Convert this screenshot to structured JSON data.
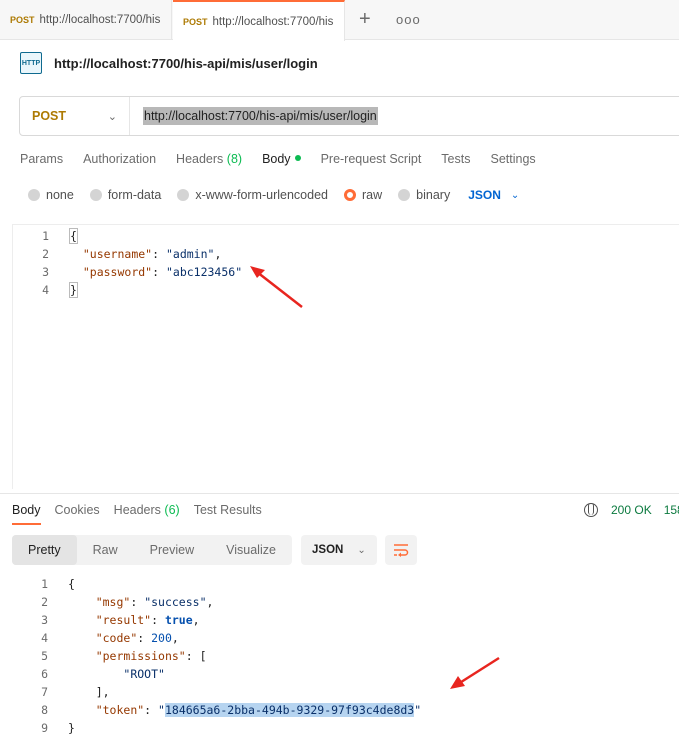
{
  "tabs": [
    {
      "method": "POST",
      "url": "http://localhost:7700/his"
    },
    {
      "method": "POST",
      "url": "http://localhost:7700/his"
    }
  ],
  "tab_actions": {
    "new": "+",
    "more": "ooo"
  },
  "request": {
    "icon_text": "HTTP",
    "title": "http://localhost:7700/his-api/mis/user/login",
    "method": "POST",
    "url": "http://localhost:7700/his-api/mis/user/login"
  },
  "request_tabs": {
    "params": "Params",
    "authorization": "Authorization",
    "headers": "Headers",
    "headers_count": "(8)",
    "body": "Body",
    "prerequest": "Pre-request Script",
    "tests": "Tests",
    "settings": "Settings"
  },
  "body_types": {
    "none": "none",
    "form_data": "form-data",
    "urlencoded": "x-www-form-urlencoded",
    "raw": "raw",
    "binary": "binary",
    "format": "JSON"
  },
  "request_body": {
    "line_numbers": [
      "1",
      "2",
      "3",
      "4"
    ],
    "username_key": "\"username\"",
    "username_value": "\"admin\"",
    "password_key": "\"password\"",
    "password_value": "\"abc123456\""
  },
  "response_tabs": {
    "body": "Body",
    "cookies": "Cookies",
    "headers": "Headers",
    "headers_count": "(6)",
    "test_results": "Test Results"
  },
  "status": {
    "code": "200 OK",
    "time": "158"
  },
  "view_modes": {
    "pretty": "Pretty",
    "raw": "Raw",
    "preview": "Preview",
    "visualize": "Visualize"
  },
  "response_format": "JSON",
  "response_body": {
    "line_numbers": [
      "1",
      "2",
      "3",
      "4",
      "5",
      "6",
      "7",
      "8",
      "9"
    ],
    "msg_key": "\"msg\"",
    "msg_value": "\"success\"",
    "result_key": "\"result\"",
    "result_value": "true",
    "code_key": "\"code\"",
    "code_value": "200",
    "permissions_key": "\"permissions\"",
    "permission_item": "\"ROOT\"",
    "token_key": "\"token\"",
    "token_value": "184665a6-2bba-494b-9329-97f93c4de8d3"
  },
  "colors": {
    "accent": "#ff6c37",
    "success": "#0cbb52",
    "method": "#ad7a03",
    "link": "#0265d2",
    "arrow": "#e8251f"
  }
}
